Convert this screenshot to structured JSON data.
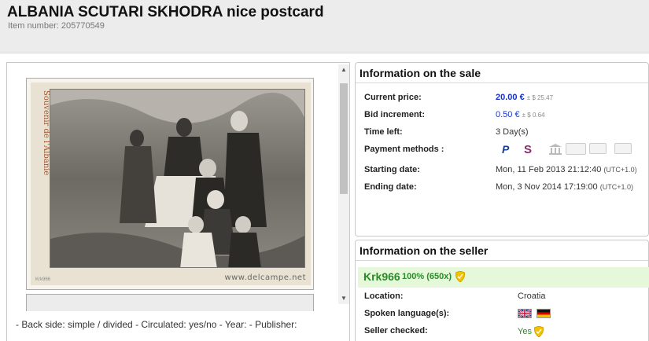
{
  "page": {
    "title": "ALBANIA SCUTARI SKHODRA nice postcard",
    "item_number": "Item number: 205770549"
  },
  "image": {
    "postcard_caption": "Souvenir de l'Albanie",
    "watermark": "www.delcampe.net",
    "seller_tag": "Krk966",
    "description": "- Back side: simple / divided - Circulated: yes/no - Year: - Publisher:"
  },
  "sale": {
    "title": "Information on the sale",
    "current_price_label": "Current price:",
    "current_price": "20.00 €",
    "current_price_alt": "± $ 25.47",
    "bid_increment_label": "Bid increment:",
    "bid_increment": "0.50 €",
    "bid_increment_alt": "± $ 0.64",
    "time_left_label": "Time left:",
    "time_left": "3 Day(s)",
    "payment_label": "Payment methods :",
    "payment_icons": [
      "paypal-icon",
      "skrill-icon",
      "bank-transfer-icon",
      "check-icon",
      "cash-icon",
      "credit-card-icon"
    ],
    "starting_label": "Starting date:",
    "starting_date": "Mon, 11 Feb 2013 21:12:40",
    "starting_tz": "(UTC+1.0)",
    "ending_label": "Ending date:",
    "ending_date": "Mon, 3 Nov 2014 17:19:00",
    "ending_tz": "(UTC+1.0)"
  },
  "seller": {
    "title": "Information on the seller",
    "name": "Krk966",
    "rating": "100% (650x)",
    "location_label": "Location:",
    "location": "Croatia",
    "languages_label": "Spoken language(s):",
    "languages": [
      "english-flag",
      "german-flag"
    ],
    "checked_label": "Seller checked:",
    "checked": "Yes"
  },
  "colors": {
    "price": "#1733c8",
    "seller_green": "#2a8a2a",
    "seller_band": "#e5f8d9",
    "header_bg": "#ececec"
  }
}
